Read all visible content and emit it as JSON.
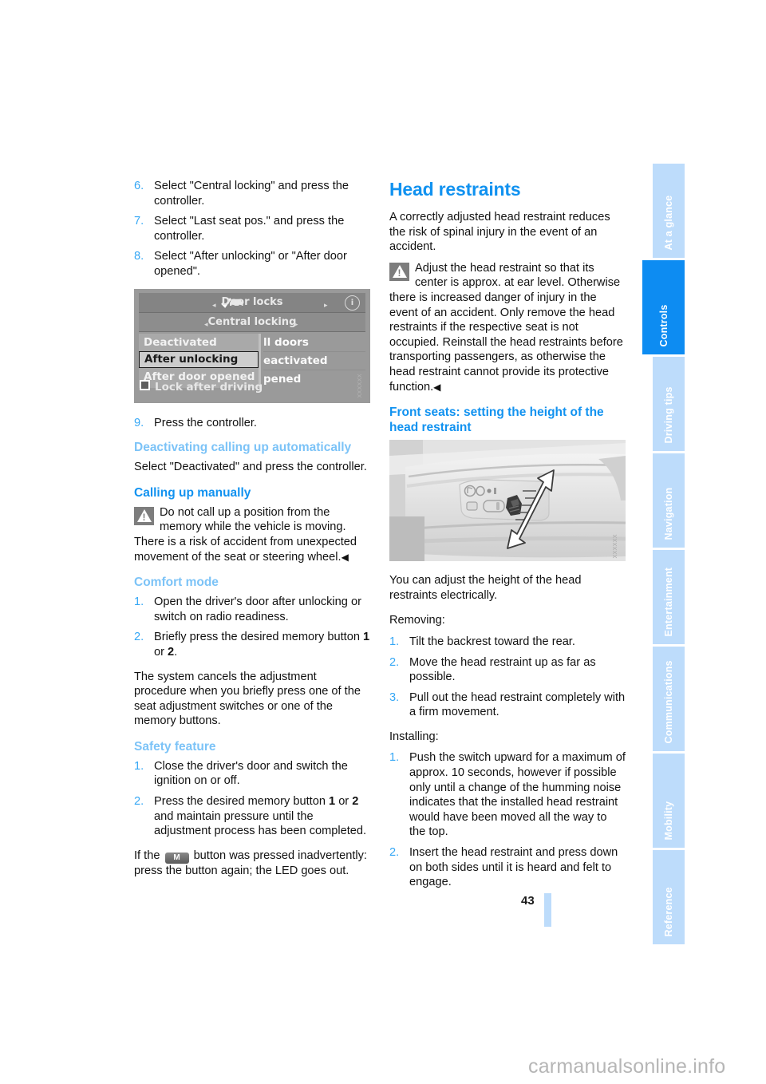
{
  "document": {
    "page_number": "43",
    "watermark": "carmanualsonline.info"
  },
  "sidebar": {
    "tabs": [
      {
        "label": "At a glance",
        "active": false
      },
      {
        "label": "Controls",
        "active": true
      },
      {
        "label": "Driving tips",
        "active": false
      },
      {
        "label": "Navigation",
        "active": false
      },
      {
        "label": "Entertainment",
        "active": false
      },
      {
        "label": "Communications",
        "active": false
      },
      {
        "label": "Mobility",
        "active": false
      },
      {
        "label": "Reference",
        "active": false
      }
    ],
    "active_color": "#0d8cf2",
    "inactive_color": "#bddcfb"
  },
  "left_column": {
    "steps_top": [
      {
        "num": "6.",
        "text": "Select \"Central locking\" and press the controller."
      },
      {
        "num": "7.",
        "text": "Select \"Last seat pos.\" and press the controller."
      },
      {
        "num": "8.",
        "text": "Select \"After unlocking\" or \"After door opened\"."
      }
    ],
    "idrive_figure": {
      "title": "Door locks",
      "subtitle": "Central locking",
      "arrow_left": "◂",
      "arrow_right": "▸",
      "info_icon_label": "i",
      "options": [
        {
          "label": "Deactivated",
          "selected": false
        },
        {
          "label": "After unlocking",
          "selected": true
        },
        {
          "label": "After door opened",
          "selected": false
        }
      ],
      "right_items": [
        "ll doors",
        "eactivated",
        "pened"
      ],
      "checkbox_label": "Lock after driving",
      "watermark": "XXXXXX"
    },
    "step_9": {
      "num": "9.",
      "text": "Press the controller."
    },
    "section_deactivating": {
      "heading": "Deactivating calling up automatically",
      "body": "Select \"Deactivated\" and press the controller."
    },
    "section_calling_manually": {
      "heading": "Calling up manually",
      "warning": "Do not call up a position from the memory while the vehicle is moving. There is a risk of accident from unexpected movement of the seat or steering wheel.",
      "warning_endmark": "◀"
    },
    "section_comfort_mode": {
      "heading": "Comfort mode",
      "steps": [
        {
          "num": "1.",
          "text": "Open the driver's door after unlocking or switch on radio readiness."
        },
        {
          "num": "2.",
          "text_pre": "Briefly press the desired memory button ",
          "bold1": "1",
          "text_mid": " or ",
          "bold2": "2",
          "text_post": "."
        }
      ],
      "body": "The system cancels the adjustment procedure when you briefly press one of the seat adjustment switches or one of the memory buttons."
    },
    "section_safety_feature": {
      "heading": "Safety feature",
      "steps": [
        {
          "num": "1.",
          "text": "Close the driver's door and switch the ignition on or off."
        },
        {
          "num": "2.",
          "text_pre": "Press the desired memory button ",
          "bold1": "1",
          "text_mid": " or ",
          "bold2": "2",
          "text_post": " and maintain pressure until the adjustment process has been completed."
        }
      ],
      "closing_pre": "If the ",
      "m_button_label": "M",
      "closing_post": " button was pressed inadvertently: press the button again; the LED goes out."
    }
  },
  "right_column": {
    "title": "Head restraints",
    "intro": "A correctly adjusted head restraint reduces the risk of spinal injury in the event of an accident.",
    "warning": "Adjust the head restraint so that its center is approx. at ear level. Otherwise there is increased danger of injury in the event of an accident. Only remove the head restraints if the respective seat is not occupied. Reinstall the head restraints before transporting passengers, as otherwise the head restraint cannot provide its protective function.",
    "warning_endmark": "◀",
    "subheading": "Front seats: setting the height of the head restraint",
    "seat_figure": {
      "watermark": "XXXXXX"
    },
    "body_after_figure": "You can adjust the height of the head restraints electrically.",
    "removing_label": "Removing:",
    "removing_steps": [
      {
        "num": "1.",
        "text": "Tilt the backrest toward the rear."
      },
      {
        "num": "2.",
        "text": "Move the head restraint up as far as possible."
      },
      {
        "num": "3.",
        "text": "Pull out the head restraint completely with a firm movement."
      }
    ],
    "installing_label": "Installing:",
    "installing_steps": [
      {
        "num": "1.",
        "text": "Push the switch upward for a maximum of approx. 10 seconds, however if possible only until a change of the humming noise indicates that the installed head restraint would have been moved all the way to the top."
      },
      {
        "num": "2.",
        "text": "Insert the head restraint and press down on both sides until it is heard and felt to engage."
      }
    ]
  }
}
